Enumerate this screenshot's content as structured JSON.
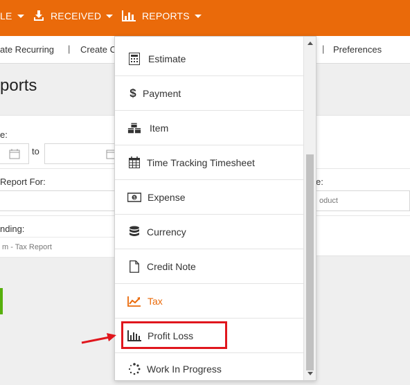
{
  "topnav": {
    "item1_label": "LE",
    "received_label": "RECEIVED",
    "reports_label": "REPORTS"
  },
  "subnav": {
    "items": [
      "ate Recurring",
      "Create C",
      "Preferences"
    ],
    "separator": "|"
  },
  "page": {
    "title": "ports"
  },
  "form": {
    "date_label": "e:",
    "to_label": "to",
    "report_for_label": "Report For:",
    "type_label": "e:",
    "type_value": "oduct",
    "heading_label": "nding:",
    "heading_value": "m - Tax Report"
  },
  "reports_menu": {
    "items": [
      {
        "label": "Estimate",
        "icon": "calculator-icon"
      },
      {
        "label": "Payment",
        "icon": "dollar-icon"
      },
      {
        "label": "Item",
        "icon": "cubes-icon"
      },
      {
        "label": "Time Tracking Timesheet",
        "icon": "calendar-icon"
      },
      {
        "label": "Expense",
        "icon": "money-icon"
      },
      {
        "label": "Currency",
        "icon": "database-icon"
      },
      {
        "label": "Credit Note",
        "icon": "document-icon"
      },
      {
        "label": "Tax",
        "icon": "line-chart-icon"
      },
      {
        "label": "Profit Loss",
        "icon": "bar-chart-icon"
      },
      {
        "label": "Work In Progress",
        "icon": "spinner-icon"
      }
    ],
    "active_item": "Tax"
  },
  "colors": {
    "brand_orange": "#ea6a0a",
    "highlight_red": "#e0161d",
    "accent_green": "#57b00c"
  }
}
